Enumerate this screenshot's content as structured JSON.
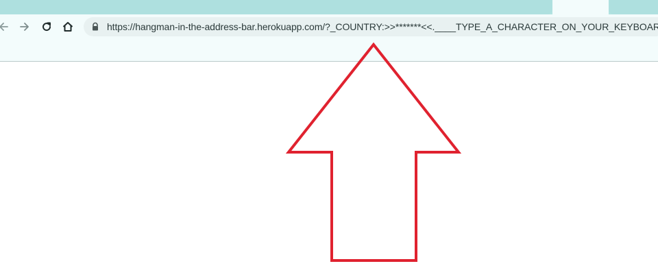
{
  "browser": {
    "address_bar": {
      "url": "https://hangman-in-the-address-bar.herokuapp.com/?_COUNTRY:>>*******<<.____TYPE_A_CHARACTER_ON_YOUR_KEYBOARD:"
    },
    "nav_icons": [
      "back-icon",
      "forward-icon",
      "reload-icon",
      "home-icon"
    ],
    "colors": {
      "tab_strip": "#aee0df",
      "toolbar": "#f3fcfc",
      "omnibox": "#e8f1f1"
    }
  },
  "annotation": {
    "icon": "red-up-arrow",
    "color": "#e0222f"
  }
}
